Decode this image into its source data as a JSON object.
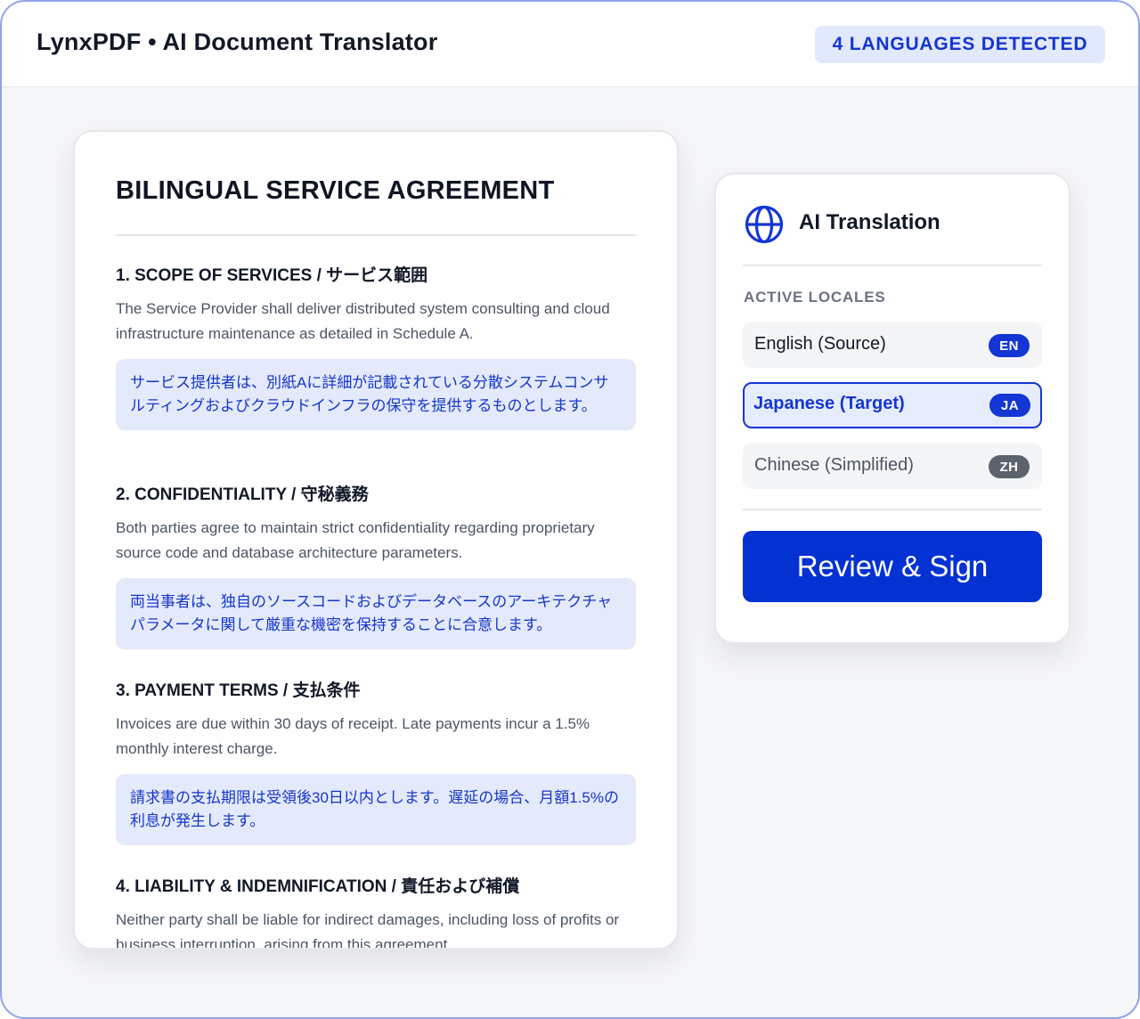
{
  "header": {
    "app_title": "LynxPDF • AI Document Translator",
    "languages_badge": "4 LANGUAGES DETECTED"
  },
  "document": {
    "title": "BILINGUAL SERVICE AGREEMENT",
    "sections": [
      {
        "heading": "1. SCOPE OF SERVICES / サービス範囲",
        "english": "The Service Provider shall deliver distributed system consulting and cloud infrastructure maintenance as detailed in Schedule A.",
        "japanese": "サービス提供者は、別紙Aに詳細が記載されている分散システムコンサルティングおよびクラウドインフラの保守を提供するものとします。"
      },
      {
        "heading": "2. CONFIDENTIALITY / 守秘義務",
        "english": "Both parties agree to maintain strict confidentiality regarding proprietary source code and database architecture parameters.",
        "japanese": "両当事者は、独自のソースコードおよびデータベースのアーキテクチャパラメータに関して厳重な機密を保持することに合意します。"
      },
      {
        "heading": "3. PAYMENT TERMS / 支払条件",
        "english": "Invoices are due within 30 days of receipt. Late payments incur a 1.5% monthly interest charge.",
        "japanese": "請求書の支払期限は受領後30日以内とします。遅延の場合、月額1.5%の利息が発生します。"
      },
      {
        "heading": "4. LIABILITY & INDEMNIFICATION / 責任および補償",
        "english": "Neither party shall be liable for indirect damages, including loss of profits or business interruption, arising from this agreement."
      }
    ]
  },
  "panel": {
    "title": "AI Translation",
    "icon": "globe-icon",
    "locales_label": "ACTIVE LOCALES",
    "locales": [
      {
        "name": "English (Source)",
        "code": "EN"
      },
      {
        "name": "Japanese (Target)",
        "code": "JA"
      },
      {
        "name": "Chinese (Simplified)",
        "code": "ZH"
      }
    ],
    "selected_locale": "Japanese (Target)",
    "cta_label": "Review & Sign"
  },
  "colors": {
    "accent": "#1336d4",
    "cta": "#0331d2",
    "translation_bg": "#e4e9fc",
    "badge_bg": "#e3e9fc",
    "zh_badge": "#5c636d"
  }
}
